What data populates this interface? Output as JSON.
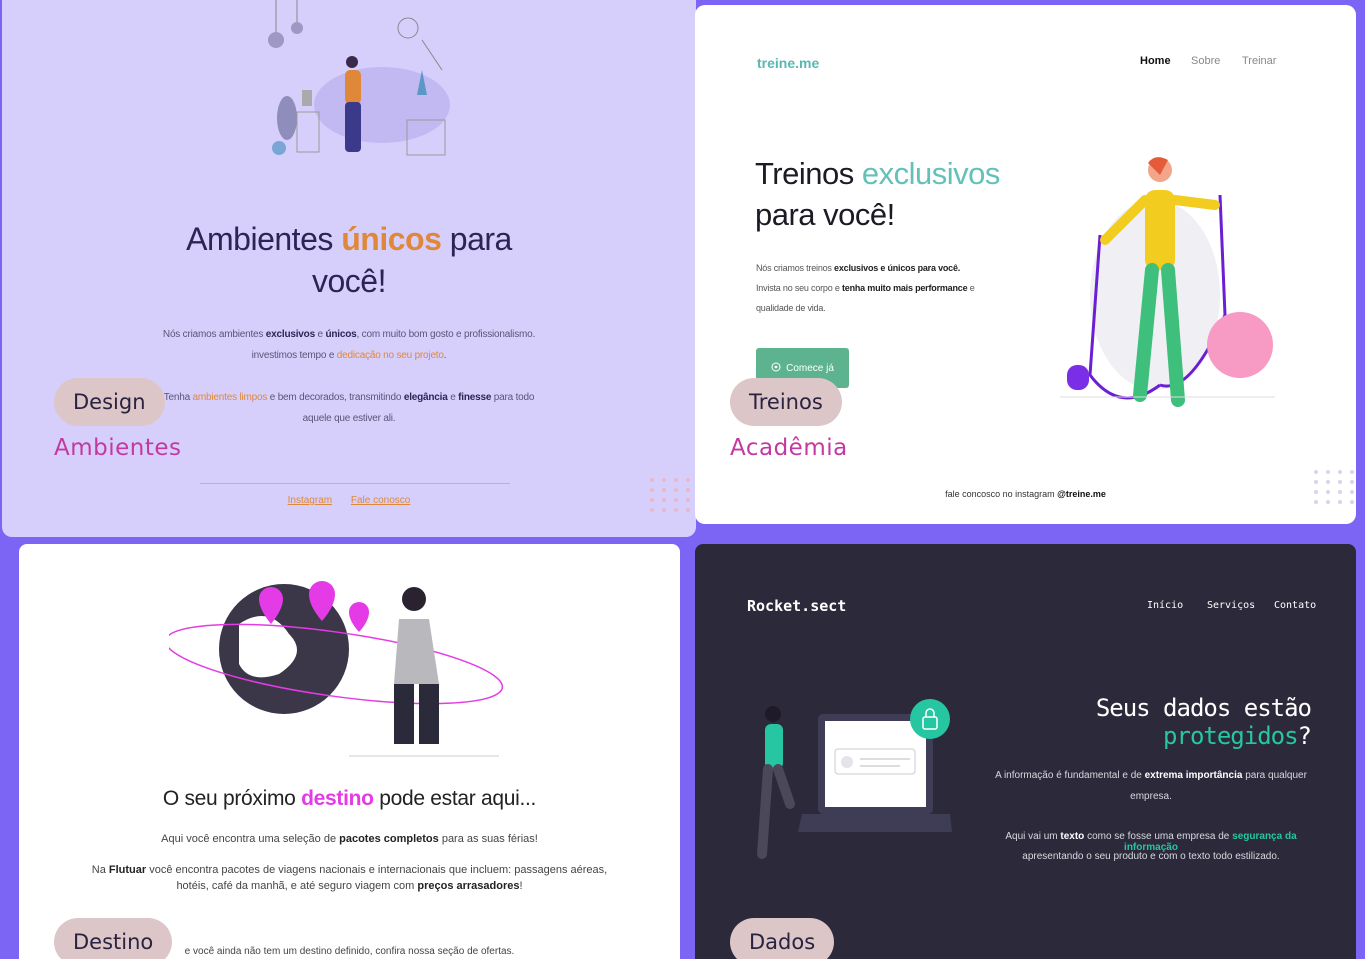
{
  "cards": {
    "ambientes": {
      "title_pre": "Ambientes ",
      "title_hl": "únicos",
      "title_post": " para",
      "title_line2": "você!",
      "p1_a": "Nós criamos ambientes ",
      "p1_b": "exclusivos",
      "p1_c": " e ",
      "p1_d": "únicos",
      "p1_e": ", com muito bom gosto e profissionalismo.",
      "p2_a": "investimos tempo e ",
      "p2_b": "dedicação no seu projeto",
      "p2_c": ".",
      "p3_a": "Tenha ",
      "p3_b": "ambientes limpos",
      "p3_c": " e bem decorados, transmitindo ",
      "p3_d": "elegância",
      "p3_e": "  e ",
      "p3_f": "finesse",
      "p3_g": " para todo",
      "p4": "aquele que estiver ali.",
      "link1": "Instagram",
      "link2": "Fale conosco",
      "badge": "Design",
      "category": "Ambientes"
    },
    "academia": {
      "logo": "treine.me",
      "nav": [
        "Home",
        "Sobre",
        "Treinar"
      ],
      "title_pre": "Treinos ",
      "title_hl": "exclusivos",
      "title_line2": "para você!",
      "p1_a": "Nós criamos treinos ",
      "p1_b": "exclusivos e únicos para você.",
      "p2_a": "Invista no seu corpo e ",
      "p2_b": "tenha muito mais performance",
      "p2_c": " e",
      "p3": "qualidade de vida.",
      "cta": "Comece já",
      "footer_a": "fale concosco no instagram ",
      "footer_b": "@treine.me",
      "badge": "Treinos",
      "category": "Acadêmia"
    },
    "destino": {
      "title_pre": "O seu próximo ",
      "title_hl": "destino",
      "title_post": " pode estar aqui...",
      "p1_a": "Aqui você encontra uma seleção de ",
      "p1_b": "pacotes completos",
      "p1_c": " para as suas férias!",
      "p2_a": "Na ",
      "p2_b": "Flutuar",
      "p2_c": " você encontra pacotes de viagens nacionais e internacionais que incluem: passagens aéreas,",
      "p3_a": "hotéis, café da manhã, e até seguro viagem com ",
      "p3_b": "preços arrasadores",
      "p3_c": "!",
      "p4": "e você ainda não tem um destino definido, confira nossa seção de ofertas.",
      "badge": "Destino"
    },
    "dados": {
      "logo": "Rocket.sect",
      "nav": [
        "Início",
        "Serviços",
        "Contato"
      ],
      "title_pre": "Seus dados estão ",
      "title_hl": "protegidos",
      "title_post": "?",
      "p1_a": "A informação é fundamental e de ",
      "p1_b": "extrema importância",
      "p1_c": " para qualquer",
      "p2": "empresa.",
      "p3_a": "Aqui vai um ",
      "p3_b": "texto",
      "p3_c": " como se fosse uma empresa de ",
      "p3_d": "segurança da informação",
      "p4": "apresentando o seu produto e com o texto todo estilizado.",
      "badge": "Dados"
    }
  },
  "colors": {
    "background": "#7c65f5",
    "badge": "#dcc6c8",
    "category": "#c4399f"
  }
}
